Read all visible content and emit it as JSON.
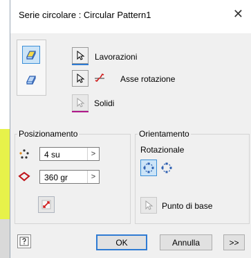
{
  "window": {
    "title": "Serie circolare : Circular Pattern1",
    "close_glyph": "✕"
  },
  "selections": {
    "features_label": "Lavorazioni",
    "axis_label": "Asse rotazione",
    "solids_label": "Solidi"
  },
  "positioning": {
    "group_label": "Posizionamento",
    "count_value": "4 su",
    "angle_value": "360 gr",
    "arrow": ">"
  },
  "orientation": {
    "group_label": "Orientamento",
    "sub_label": "Rotazionale",
    "base_point_label": "Punto di base"
  },
  "footer": {
    "ok_label": "OK",
    "cancel_label": "Annulla",
    "more_label": ">>"
  },
  "colors": {
    "features_underline": "#2f7bd3",
    "solids_underline": "#b0188a",
    "accent": "#3a8fd8"
  }
}
